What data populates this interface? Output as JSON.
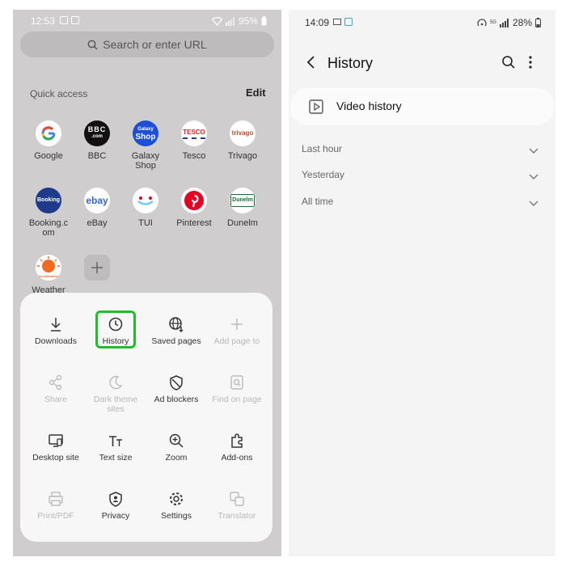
{
  "left": {
    "status": {
      "time": "12:53",
      "battery": "95%"
    },
    "search": {
      "placeholder": "Search or enter URL"
    },
    "quick_access": {
      "title": "Quick access",
      "edit_label": "Edit",
      "tiles": [
        {
          "label": "Google",
          "logo": "google-logo",
          "color": "#ffffff"
        },
        {
          "label": "BBC",
          "logo": "bbc-logo",
          "color": "#111111"
        },
        {
          "label": "Galaxy Shop",
          "logo": "galaxy-shop-logo",
          "color": "#1b4fd8"
        },
        {
          "label": "Tesco",
          "logo": "tesco-logo",
          "color": "#ffffff"
        },
        {
          "label": "Trivago",
          "logo": "trivago-logo",
          "color": "#ffffff"
        },
        {
          "label": "Booking.com",
          "logo": "booking-logo",
          "color": "#1d3b8a"
        },
        {
          "label": "eBay",
          "logo": "ebay-logo",
          "color": "#ffffff"
        },
        {
          "label": "TUI",
          "logo": "tui-logo",
          "color": "#ffffff"
        },
        {
          "label": "Pinterest",
          "logo": "pinterest-logo",
          "color": "#e60023"
        },
        {
          "label": "Dunelm",
          "logo": "dunelm-logo",
          "color": "#ffffff"
        },
        {
          "label": "Weather",
          "logo": "accuweather-logo",
          "color": "#f26a22"
        }
      ],
      "logo_text": {
        "bbc": "BBC",
        "bbc_sub": ".com",
        "galaxy_1": "Galaxy",
        "galaxy_2": "Shop",
        "tesco": "TESCO",
        "trivago": "trivago",
        "booking": "Booking",
        "ebay": "ebay",
        "dunelm": "Dunelm",
        "accuweather": "AccuWeather"
      }
    },
    "menu": {
      "items": [
        {
          "label": "Downloads",
          "enabled": true
        },
        {
          "label": "History",
          "enabled": true
        },
        {
          "label": "Saved pages",
          "enabled": true
        },
        {
          "label": "Add page to",
          "enabled": false
        },
        {
          "label": "Share",
          "enabled": false
        },
        {
          "label": "Dark theme sites",
          "enabled": false
        },
        {
          "label": "Ad blockers",
          "enabled": true
        },
        {
          "label": "Find on page",
          "enabled": false
        },
        {
          "label": "Desktop site",
          "enabled": true
        },
        {
          "label": "Text size",
          "enabled": true
        },
        {
          "label": "Zoom",
          "enabled": true
        },
        {
          "label": "Add-ons",
          "enabled": true
        },
        {
          "label": "Print/PDF",
          "enabled": false
        },
        {
          "label": "Privacy",
          "enabled": true
        },
        {
          "label": "Settings",
          "enabled": true
        },
        {
          "label": "Translator",
          "enabled": false
        }
      ],
      "highlight_color": "#1fbe2a"
    }
  },
  "right": {
    "status": {
      "time": "14:09",
      "battery": "28%",
      "network": "5G"
    },
    "header": {
      "title": "History"
    },
    "video_history_label": "Video history",
    "sections": [
      {
        "label": "Last hour"
      },
      {
        "label": "Yesterday"
      },
      {
        "label": "All time"
      }
    ]
  }
}
